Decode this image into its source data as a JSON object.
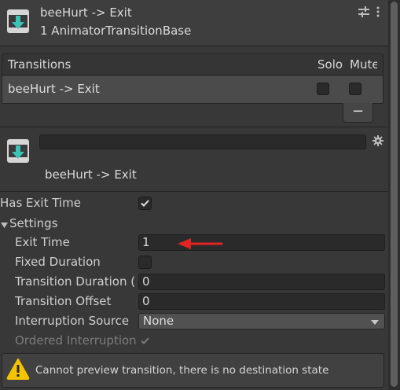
{
  "header": {
    "title": "beeHurt -> Exit",
    "subtitle": "1 AnimatorTransitionBase",
    "icon": "transition-asset-icon"
  },
  "transitions_list": {
    "columns": [
      "Transitions",
      "Solo",
      "Mute"
    ],
    "rows": [
      {
        "name": "beeHurt -> Exit",
        "solo": false,
        "mute": false
      }
    ],
    "remove_button": "−"
  },
  "transition": {
    "name_field_value": "",
    "title": "beeHurt -> Exit"
  },
  "properties": {
    "has_exit_time": {
      "label": "Has Exit Time",
      "checked": true
    },
    "settings_foldout": {
      "label": "Settings",
      "expanded": true
    },
    "exit_time": {
      "label": "Exit Time",
      "value": "1"
    },
    "fixed_duration": {
      "label": "Fixed Duration",
      "checked": false
    },
    "transition_duration": {
      "label": "Transition Duration (",
      "value": "0"
    },
    "transition_offset": {
      "label": "Transition Offset",
      "value": "0"
    },
    "interruption_source": {
      "label": "Interruption Source",
      "value": "None"
    },
    "ordered_interruption": {
      "label": "Ordered Interruption",
      "checked": true,
      "disabled": true
    }
  },
  "warning": {
    "text": "Cannot preview transition, there is no destination state",
    "icon": "warning-icon"
  },
  "colors": {
    "accent_teal": "#39c4b6",
    "annotation_arrow": "#e02424",
    "warning_yellow": "#f5c400"
  }
}
